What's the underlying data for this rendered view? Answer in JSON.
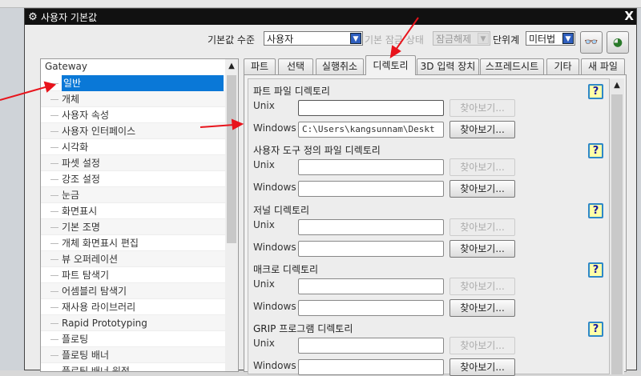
{
  "dialog": {
    "title": "사용자 기본값",
    "close_label": "X"
  },
  "toolbar": {
    "level_label": "기본값 수준",
    "level_value": "사용자",
    "lock_label": "기본 잠금 상태",
    "lock_value": "잠금해제",
    "units_label": "단위계",
    "units_value": "미터법"
  },
  "tree": {
    "root": "Gateway",
    "items": [
      "일반",
      "개체",
      "사용자 속성",
      "사용자 인터페이스",
      "시각화",
      "파셋 설정",
      "강조 설정",
      "눈금",
      "화면표시",
      "기본 조명",
      "개체 화면표시 편집",
      "뷰 오퍼레이션",
      "파트 탐색기",
      "어셈블리 탐색기",
      "재사용 라이브러리",
      "Rapid Prototyping",
      "플로팅",
      "플로팅 배너",
      "플로팅 배너 원점"
    ],
    "selected": "일반"
  },
  "tabs": [
    "파트",
    "선택",
    "실행취소",
    "디렉토리",
    "3D 입력 장치",
    "스프레드시트",
    "기타",
    "새 파일"
  ],
  "active_tab": "디렉토리",
  "sections": [
    {
      "title": "파트 파일 디렉토리",
      "unix_label": "Unix",
      "unix_value": "",
      "windows_label": "Windows",
      "windows_value": "C:\\Users\\kangsunnam\\Deskt",
      "browse": "찾아보기..."
    },
    {
      "title": "사용자 도구 정의 파일 디렉토리",
      "unix_label": "Unix",
      "unix_value": "",
      "windows_label": "Windows",
      "windows_value": "",
      "browse": "찾아보기..."
    },
    {
      "title": "저널 디렉토리",
      "unix_label": "Unix",
      "unix_value": "",
      "windows_label": "Windows",
      "windows_value": "",
      "browse": "찾아보기..."
    },
    {
      "title": "매크로 디렉토리",
      "unix_label": "Unix",
      "unix_value": "",
      "windows_label": "Windows",
      "windows_value": "",
      "browse": "찾아보기..."
    },
    {
      "title": "GRIP 프로그램 디렉토리",
      "unix_label": "Unix",
      "unix_value": "",
      "windows_label": "Windows",
      "windows_value": "",
      "browse": "찾아보기..."
    }
  ],
  "help_label": "?",
  "colors": {
    "selection": "#0a78d7",
    "titlebar": "#111111",
    "annotation_arrow": "#e8141c"
  }
}
